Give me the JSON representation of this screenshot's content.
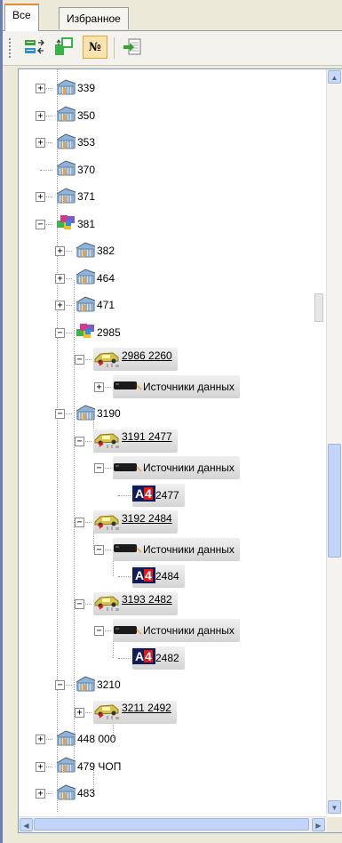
{
  "tabs": [
    {
      "label": "Все",
      "active": true
    },
    {
      "label": "Избранное",
      "active": false
    }
  ],
  "toolbar": {
    "buttons": [
      {
        "name": "expand-collapse-icon"
      },
      {
        "name": "group-nodes-icon"
      },
      {
        "name": "numbering-toggle",
        "label": "№",
        "pressed": true
      },
      {
        "name": "export-icon"
      }
    ]
  },
  "tree": {
    "nodes": [
      {
        "label": "339",
        "icon": "building-icon",
        "level": 1,
        "expander": "+"
      },
      {
        "label": "350",
        "icon": "building-icon",
        "level": 1,
        "expander": "+"
      },
      {
        "label": "353",
        "icon": "building-icon",
        "level": 1,
        "expander": "+"
      },
      {
        "label": "370",
        "icon": "building-icon",
        "level": 1,
        "expander": ""
      },
      {
        "label": "371",
        "icon": "building-icon",
        "level": 1,
        "expander": "+"
      },
      {
        "label": "381",
        "icon": "cubes-icon",
        "level": 1,
        "expander": "−"
      },
      {
        "label": "382",
        "icon": "building-icon",
        "level": 2,
        "expander": "+"
      },
      {
        "label": "464",
        "icon": "building-icon",
        "level": 2,
        "expander": "+"
      },
      {
        "label": "471",
        "icon": "building-icon",
        "level": 2,
        "expander": "+"
      },
      {
        "label": "2985",
        "icon": "cubes-icon",
        "level": 2,
        "expander": "−"
      },
      {
        "label": "2986 2260",
        "icon": "vehicle-icon",
        "level": 3,
        "expander": "−",
        "pill": true
      },
      {
        "label": "Источники данных",
        "icon": "device-icon",
        "level": 4,
        "expander": "+",
        "pill": true
      },
      {
        "label": "3190",
        "icon": "building-icon",
        "level": 2,
        "expander": "−"
      },
      {
        "label": "3191 2477",
        "icon": "vehicle-icon",
        "level": 3,
        "expander": "−",
        "pill": true
      },
      {
        "label": "Источники данных",
        "icon": "device-icon",
        "level": 4,
        "expander": "−",
        "pill": true
      },
      {
        "label": "2477",
        "icon": "a4-icon",
        "level": 5,
        "expander": "",
        "pill": true
      },
      {
        "label": "3192 2484",
        "icon": "vehicle-icon",
        "level": 3,
        "expander": "−",
        "pill": true
      },
      {
        "label": "Источники данных",
        "icon": "device-icon",
        "level": 4,
        "expander": "−",
        "pill": true
      },
      {
        "label": "2484",
        "icon": "a4-icon",
        "level": 5,
        "expander": "",
        "pill": true
      },
      {
        "label": "3193 2482",
        "icon": "vehicle-icon",
        "level": 3,
        "expander": "−",
        "pill": true
      },
      {
        "label": "Источники данных",
        "icon": "device-icon",
        "level": 4,
        "expander": "−",
        "pill": true
      },
      {
        "label": "2482",
        "icon": "a4-icon",
        "level": 5,
        "expander": "",
        "pill": true
      },
      {
        "label": "3210",
        "icon": "building-icon",
        "level": 2,
        "expander": "−"
      },
      {
        "label": "3211 2492",
        "icon": "vehicle-icon",
        "level": 3,
        "expander": "+",
        "pill": true
      },
      {
        "label": "448 000",
        "icon": "building-icon",
        "level": 1,
        "expander": "+"
      },
      {
        "label": "479 ЧОП",
        "icon": "building-icon",
        "level": 1,
        "expander": "+"
      },
      {
        "label": "483",
        "icon": "building-icon",
        "level": 1,
        "expander": "+"
      }
    ]
  },
  "colors": {
    "accent": "#e68b2c",
    "scroll": "#c2d5f8",
    "border": "#7f9db9"
  }
}
